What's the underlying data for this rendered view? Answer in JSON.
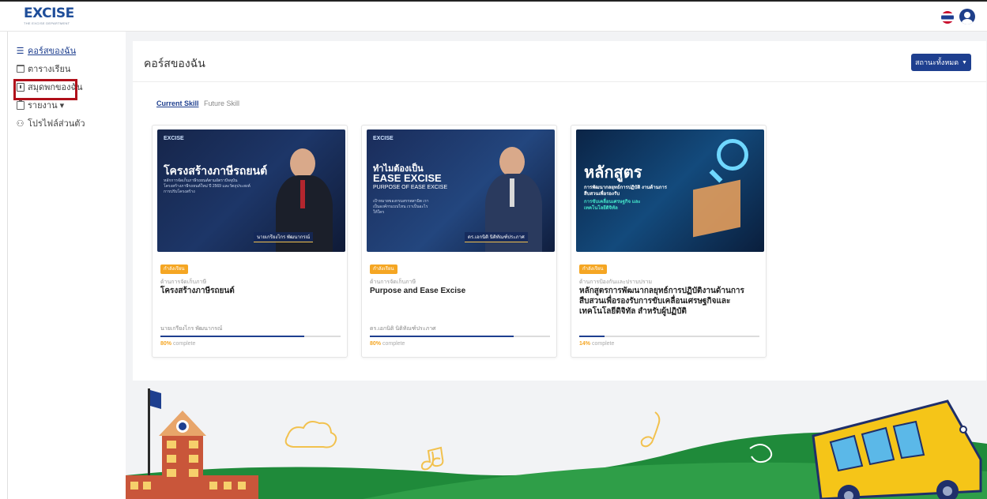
{
  "header": {
    "logo_text": "EXCISE",
    "logo_subtext": "THE EXCISE DEPARTMENT",
    "language_flag": "thai-flag-icon",
    "user_icon": "user-circle-icon"
  },
  "sidebar": {
    "items": [
      {
        "label": "คอร์สของฉัน",
        "icon": "list-icon",
        "active": true
      },
      {
        "label": "ตารางเรียน",
        "icon": "calendar-icon",
        "active": false
      },
      {
        "label": "สมุดพกของฉัน",
        "icon": "book-icon",
        "active": false
      },
      {
        "label": "รายงาน ▾",
        "icon": "clipboard-icon",
        "active": false
      },
      {
        "label": "โปรไฟล์ส่วนตัว",
        "icon": "users-icon",
        "active": false
      }
    ]
  },
  "main": {
    "title": "คอร์สของฉัน",
    "status_button": "สถานะทั้งหมด",
    "tabs": [
      {
        "label": "Current Skill",
        "active": true
      },
      {
        "label": "Future Skill",
        "active": false
      }
    ],
    "courses": [
      {
        "thumb_heading": "โครงสร้างภาษีรถยนต์",
        "thumb_caption": "หลักการจัดเก็บภาษีรถยนต์ตามอัตราปัจจุบัน โครงสร้างภาษีรถยนต์ใหม่ ปี 2569 และวัตถุประสงค์การปรับโครงสร้าง",
        "thumb_name": "นายเกรียงไกร พัฒนากรณ์",
        "badge": "กำลังเรียน",
        "category": "ด้านการจัดเก็บภาษี",
        "title": "โครงสร้างภาษีรถยนต์",
        "instructor": "นายเกรียงไกร พัฒนากรณ์",
        "progress": 80,
        "progress_pct_text": "80%",
        "progress_suffix": "complete"
      },
      {
        "thumb_heading_th": "ทำไมต้องเป็น",
        "thumb_heading_en": "EASE EXCISE",
        "thumb_sub": "PURPOSE OF EASE EXCISE",
        "thumb_caption": "เป้าหมายของกรมสรรพสามิต เราเป็นองค์กรแบบไหน เราเป็นอะไรให้ใคร",
        "thumb_name": "ดร.เอกนิติ นิติทัณฑ์ประภาศ",
        "badge": "กำลังเรียน",
        "category": "ด้านการจัดเก็บภาษี",
        "title": "Purpose and Ease Excise",
        "instructor": "ดร.เอกนิติ นิติทัณฑ์ประภาศ",
        "progress": 80,
        "progress_pct_text": "80%",
        "progress_suffix": "complete"
      },
      {
        "thumb_heading": "หลักสูตร",
        "thumb_caption1": "การพัฒนากลยุทธ์การปฏิบัติ งานด้านการสืบสวนเพื่อรองรับ",
        "thumb_caption2": "การขับเคลื่อนเศรษฐกิจ และเทคโนโลยีดิจิทัล",
        "badge": "กำลังเรียน",
        "category": "ด้านการป้องกันและปราบปราม",
        "title": "หลักสูตรการพัฒนากลยุทธ์การปฏิบัติงานด้านการสืบสวนเพื่อรองรับการขับเคลื่อนเศรษฐกิจและเทคโนโลยีดิจิทัล สำหรับผู้ปฏิบัติ",
        "instructor": "",
        "progress": 14,
        "progress_pct_text": "14%",
        "progress_suffix": "complete"
      }
    ]
  },
  "colors": {
    "primary": "#1e3f8f",
    "badge": "#f5a623",
    "highlight_box": "#b0101a"
  }
}
